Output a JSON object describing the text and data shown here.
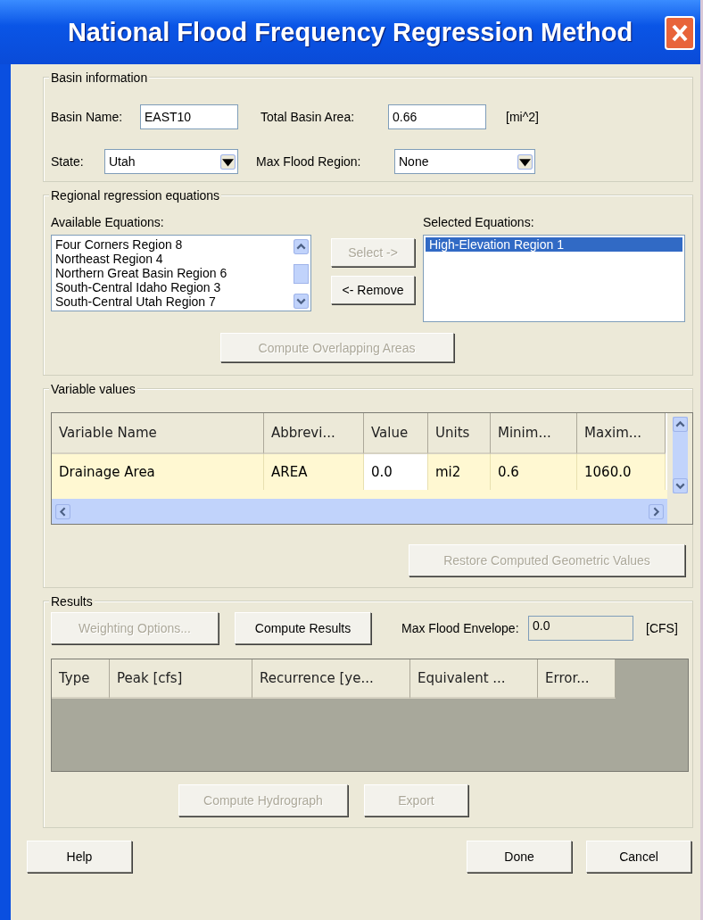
{
  "window": {
    "title": "National Flood Frequency Regression Method"
  },
  "basin_information": {
    "title": "Basin information",
    "fields": [
      {
        "kind": "text",
        "label": "Basin Name:",
        "value": "EAST10"
      },
      {
        "kind": "text",
        "label": "Total Basin Area:",
        "value": "0.66",
        "unit": "[mi^2]"
      },
      {
        "kind": "dropdown",
        "label": "State:",
        "value": "Utah"
      },
      {
        "kind": "dropdown",
        "label": "Max Flood Region:",
        "value": "None"
      }
    ]
  },
  "regional_equations": {
    "title": "Regional regression equations",
    "available_label": "Available Equations:",
    "available": [
      {
        "label": "Four Corners Region 8",
        "selected": false
      },
      {
        "label": "Northeast Region 4",
        "selected": false
      },
      {
        "label": "Northern Great Basin Region 6",
        "selected": false
      },
      {
        "label": "South-Central Idaho Region 3",
        "selected": false
      },
      {
        "label": "South-Central Utah Region 7",
        "selected": false
      }
    ],
    "selected_label": "Selected Equations:",
    "selected_equations": [
      {
        "label": "High-Elevation Region 1",
        "selected": true
      }
    ],
    "move_buttons": [
      {
        "label": "Select ->",
        "disabled": true
      },
      {
        "label": "<- Remove",
        "disabled": false
      }
    ],
    "compute_button": {
      "label": "Compute Overlapping Areas",
      "disabled": true
    }
  },
  "variable_values": {
    "title": "Variable values",
    "table": {
      "columns": [
        "Variable Name",
        "Abbrevi...",
        "Value",
        "Units",
        "Minim...",
        "Maxim..."
      ],
      "rows": [
        {
          "cells": [
            {
              "text": "Drainage Area",
              "editable": false
            },
            {
              "text": "AREA",
              "editable": false
            },
            {
              "text": "0.0",
              "editable": true
            },
            {
              "text": "mi2",
              "editable": false
            },
            {
              "text": "0.6",
              "editable": false
            },
            {
              "text": "1060.0",
              "editable": false
            }
          ]
        }
      ]
    },
    "restore_button": {
      "label": "Restore Computed Geometric Values",
      "disabled": true
    }
  },
  "results": {
    "title": "Results",
    "weighting_button": {
      "label": "Weighting Options...",
      "disabled": true
    },
    "compute_button": {
      "label": "Compute Results",
      "disabled": false
    },
    "envelope_label": "Max Flood Envelope:",
    "envelope_value": "0.0",
    "envelope_unit": "[CFS]",
    "table": {
      "columns": [
        "Type",
        "Peak [cfs]",
        "Recurrence [ye...",
        "Equivalent ...",
        "Error..."
      ]
    },
    "buttons": [
      {
        "label": "Compute Hydrograph",
        "disabled": true
      },
      {
        "label": "Export",
        "disabled": true
      }
    ]
  },
  "footer_buttons": [
    {
      "label": "Help",
      "disabled": false
    },
    {
      "label": "Done",
      "disabled": false
    },
    {
      "label": "Cancel",
      "disabled": false
    }
  ]
}
